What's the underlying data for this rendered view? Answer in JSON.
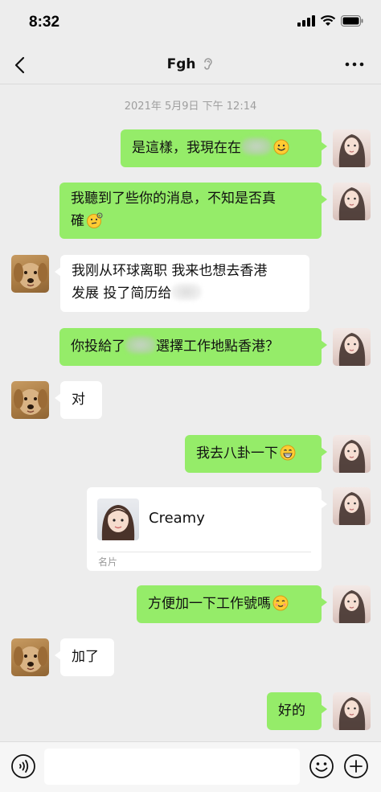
{
  "status_bar": {
    "time": "8:32"
  },
  "nav": {
    "title": "Fgh"
  },
  "timestamp": "2021年 5月9日 下午 12:14",
  "messages": {
    "m1": {
      "text": "是這樣，我現在在"
    },
    "m2": {
      "line1": "我聽到了些你的消息，不知是否真",
      "line2": "確"
    },
    "m3": {
      "line1": "我刚从环球离职 我来也想去香港",
      "line2": "发展 投了简历给"
    },
    "m4": {
      "text_a": "你投給了",
      "text_b": "選擇工作地點香港？"
    },
    "m5": {
      "text": "对"
    },
    "m6": {
      "text": "我去八卦一下"
    },
    "card": {
      "name": "Creamy",
      "label": "名片"
    },
    "m7": {
      "text": "方便加一下工作號嗎"
    },
    "m8": {
      "text": "加了"
    },
    "m9": {
      "text": "好的"
    }
  },
  "colors": {
    "bubble_me": "#95ec69",
    "bubble_other": "#ffffff",
    "background": "#ededed"
  },
  "icons": [
    "back-icon",
    "ear-icon",
    "more-icon",
    "voice-icon",
    "emoji-icon",
    "plus-icon"
  ]
}
